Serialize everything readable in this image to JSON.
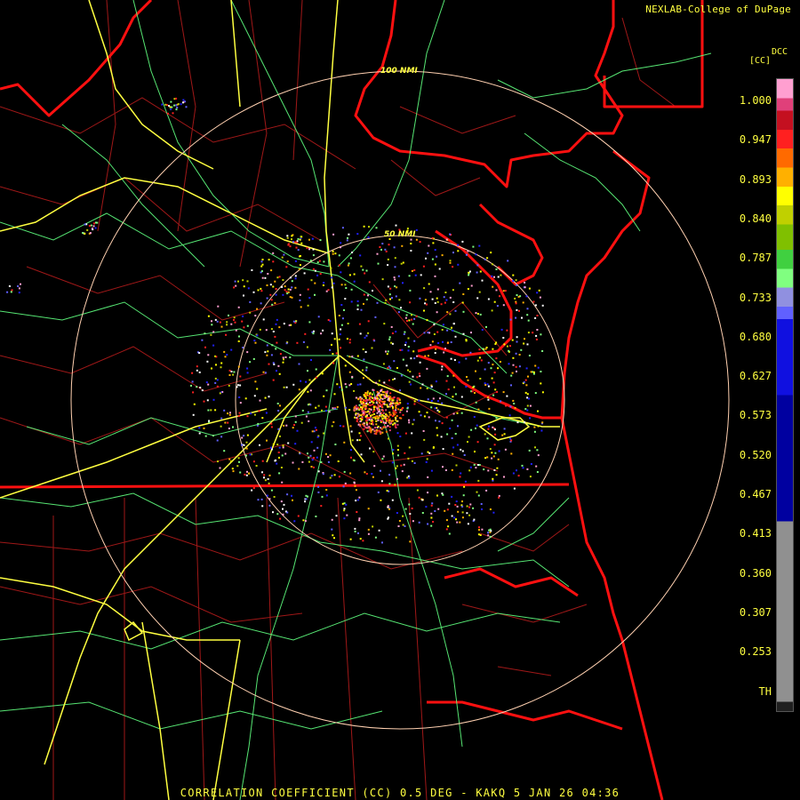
{
  "credit": "NEXLAB-College of DuPage",
  "product": "CORRELATION COEFFICIENT (CC) 0.5 DEG - KAKQ 5 JAN 26 04:36",
  "range_rings": [
    {
      "label": "100 NMI"
    },
    {
      "label": "50 NMI"
    }
  ],
  "legend": {
    "title": "DCC",
    "unit": "[CC]",
    "labels": [
      "1.000",
      "0.947",
      "0.893",
      "0.840",
      "0.787",
      "0.733",
      "0.680",
      "0.627",
      "0.573",
      "0.520",
      "0.467",
      "0.413",
      "0.360",
      "0.307",
      "0.253",
      "TH"
    ],
    "colors": [
      "#ff9fd0",
      "#e0407a",
      "#c41020",
      "#ff2020",
      "#ff6a00",
      "#ffb000",
      "#ffff00",
      "#c0d000",
      "#80c000",
      "#40d040",
      "#80ff80",
      "#9090e0",
      "#6060ff",
      "#1010e0",
      "#0000a0",
      "#909090",
      "#202020"
    ]
  },
  "colors": {
    "state_border": "#ff1010",
    "county_border": "#b01818",
    "highway": "#ffff40",
    "road": "#60ff80",
    "ring": "#ffd0b0"
  }
}
